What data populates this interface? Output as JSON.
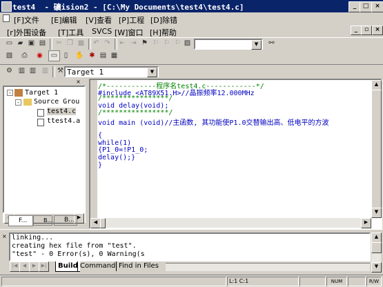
{
  "window": {
    "title": "test4  - 礦ision2 - [C:\\My Documents\\test4\\test4.c]",
    "minimize": "_",
    "maximize": "□",
    "close": "×",
    "doc_minimize": "_",
    "doc_restore": "▫",
    "doc_close": "×"
  },
  "menu": {
    "row1": [
      "[F]文件",
      "[E]编辑",
      "[V]查看",
      "[P]工程",
      "[D]除错"
    ],
    "row2": [
      "[r]外围设备",
      "[T]工具",
      "SVCS",
      "[W]窗口",
      "[H]帮助"
    ]
  },
  "toolbar": {
    "find_combo_value": "",
    "target_combo_value": "Target 1"
  },
  "project": {
    "target": "Target 1",
    "group": "Source Grou",
    "files": [
      "test4.c",
      "ttest4.a"
    ],
    "tabs": [
      "F...",
      "B...",
      "B..."
    ]
  },
  "editor": {
    "lines": [
      "/*------------程序名test4.c------------*/",
      "#include <AT89X51.H>//晶振频率12.000MHz",
      "/****************/",
      "void delay(void);",
      "/****************/",
      "void main (void)//主函数, 其功能使P1.0交替输出高、低电平的方波",
      "",
      "{",
      "while(1)",
      "{P1_0=!P1_0;",
      "delay();}",
      "}"
    ]
  },
  "output": {
    "lines": [
      "linking...",
      "creating hex file from \"test\".",
      "\"test\" - 0 Error(s), 0 Warning(s"
    ],
    "tabs": [
      "Build",
      "Command",
      "Find in Files"
    ]
  },
  "status": {
    "position": "L:1 C:1",
    "mode1": "NUM",
    "mode2": "R/W"
  }
}
